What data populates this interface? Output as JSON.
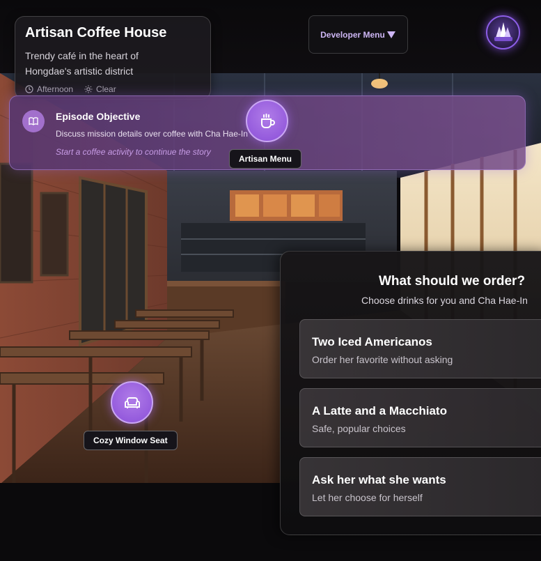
{
  "location": {
    "title": "Artisan Coffee House",
    "description": "Trendy café in the heart of Hongdae's artistic district",
    "time": "Afternoon",
    "weather": "Clear"
  },
  "developer_menu": {
    "label": "Developer Menu"
  },
  "objective": {
    "title": "Episode Objective",
    "description": "Discuss mission details over coffee with Cha Hae-In",
    "hint": "Start a coffee activity to continue the story"
  },
  "hotspots": [
    {
      "label": "Artisan Menu",
      "icon": "coffee-cup-icon"
    },
    {
      "label": "Cozy Window Seat",
      "icon": "sofa-icon"
    }
  ],
  "choices": {
    "title": "What should we order?",
    "subtitle": "Choose drinks for you and Cha Hae-In",
    "options": [
      {
        "label": "Two Iced Americanos",
        "description": "Order her favorite without asking"
      },
      {
        "label": "A Latte and a Macchiato",
        "description": "Safe, popular choices"
      },
      {
        "label": "Ask her what she wants",
        "description": "Let her choose for herself"
      }
    ]
  },
  "colors": {
    "accent": "#9b5de5",
    "hint": "#c79ce6",
    "panel": "#141315"
  }
}
